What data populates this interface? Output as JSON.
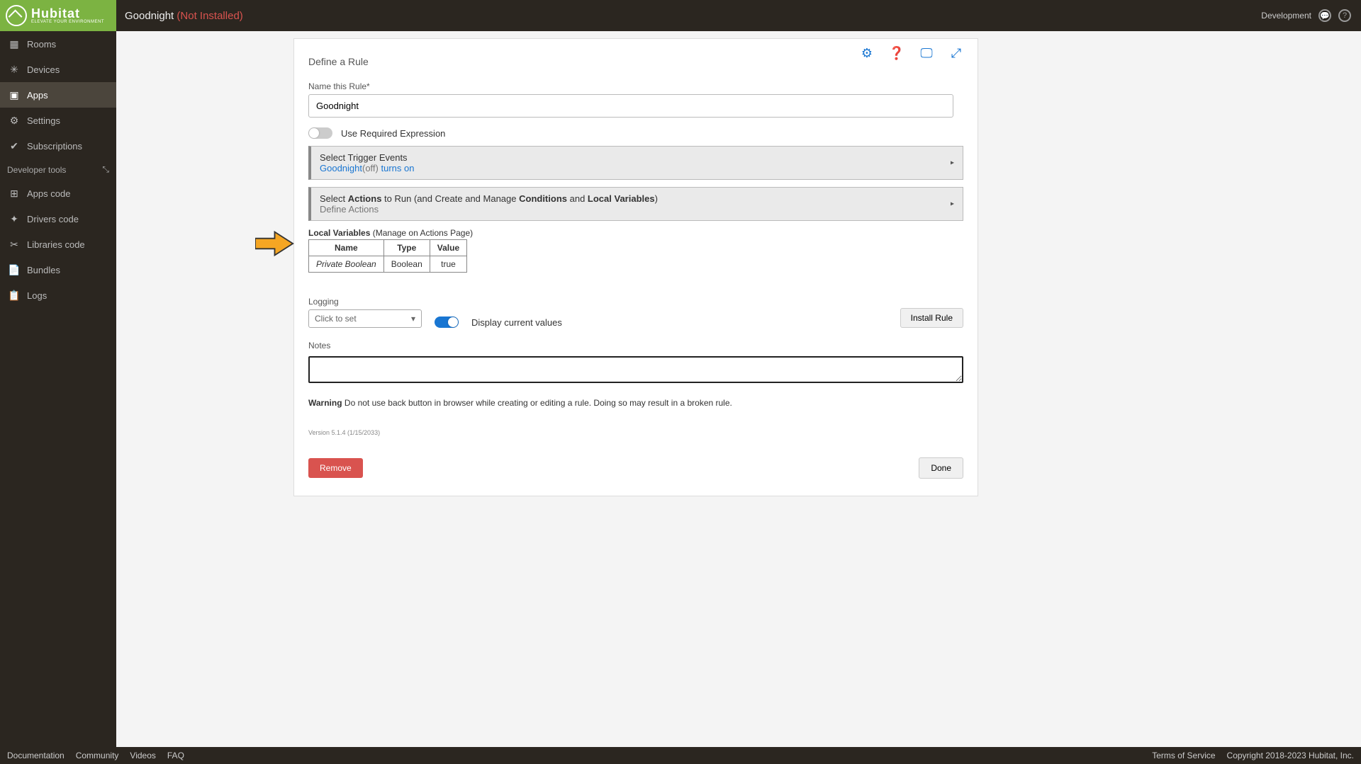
{
  "brand": {
    "name": "Hubitat",
    "tag": "ELEVATE YOUR ENVIRONMENT"
  },
  "header": {
    "title": "Goodnight",
    "status": "(Not Installed)",
    "env": "Development"
  },
  "sidebar": {
    "items": [
      {
        "label": "Rooms"
      },
      {
        "label": "Devices"
      },
      {
        "label": "Apps"
      },
      {
        "label": "Settings"
      },
      {
        "label": "Subscriptions"
      }
    ],
    "devtools": "Developer tools",
    "dev": [
      {
        "label": "Apps code"
      },
      {
        "label": "Drivers code"
      },
      {
        "label": "Libraries code"
      },
      {
        "label": "Bundles"
      },
      {
        "label": "Logs"
      }
    ]
  },
  "page": {
    "heading": "Define a Rule",
    "name_label": "Name this Rule*",
    "name_value": "Goodnight",
    "use_req_expr": "Use Required Expression",
    "trigger": {
      "title": "Select Trigger Events",
      "device": "Goodnight",
      "state": "(off)",
      "action": "turns on"
    },
    "actions": {
      "p1": "Select ",
      "p2": "Actions",
      "p3": " to Run (and Create and Manage ",
      "p4": "Conditions",
      "p5": " and ",
      "p6": "Local Variables",
      "p7": ")",
      "sub": "Define Actions"
    },
    "localvars": {
      "title": "Local Variables",
      "hint": " (Manage on Actions Page)",
      "cols": {
        "c1": "Name",
        "c2": "Type",
        "c3": "Value"
      },
      "row": {
        "c1": "Private Boolean",
        "c2": "Boolean",
        "c3": "true"
      }
    },
    "logging_label": "Logging",
    "logging_sel": "Click to set",
    "display_cur": "Display current values",
    "install": "Install Rule",
    "notes_label": "Notes",
    "warn_b": "Warning",
    "warn_t": " Do not use back button in browser while creating or editing a rule. Doing so may result in a broken rule.",
    "version": "Version 5.1.4 (1/15/2033)",
    "remove": "Remove",
    "done": "Done"
  },
  "footer": {
    "l1": "Documentation",
    "l2": "Community",
    "l3": "Videos",
    "l4": "FAQ",
    "r1": "Terms of Service",
    "r2": "Copyright 2018-2023 Hubitat, Inc."
  }
}
